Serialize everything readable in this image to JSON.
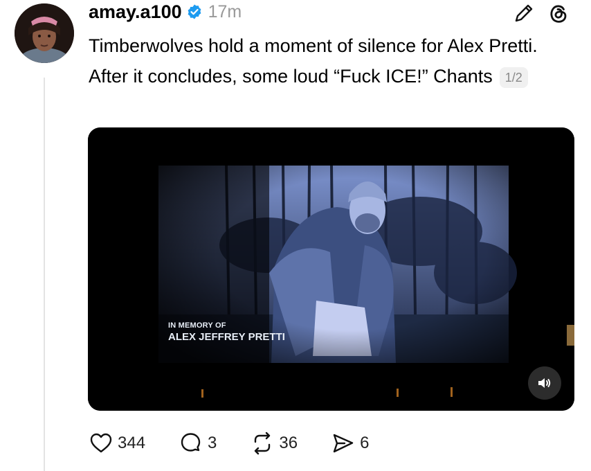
{
  "post": {
    "username": "amay.a100",
    "timestamp": "17m",
    "text": "Timberwolves hold a moment of silence for Alex Pretti. After it concludes, some loud “Fuck ICE!” Chants",
    "media_counter": "1/2"
  },
  "video": {
    "caption_line1": "IN MEMORY OF",
    "caption_line2": "ALEX JEFFREY PRETTI",
    "sound_icon": "speaker-icon"
  },
  "actions": {
    "likes": "344",
    "replies": "3",
    "reposts": "36",
    "shares": "6"
  },
  "colors": {
    "text": "#000000",
    "muted": "#999999",
    "verified": "#1d9bf0",
    "video_bg": "#000000",
    "tint": "#6f86c9"
  },
  "icons": [
    "verified-badge-icon",
    "edit-pencil-icon",
    "threads-logo-icon",
    "heart-icon",
    "reply-icon",
    "repost-icon",
    "share-icon",
    "speaker-icon"
  ]
}
